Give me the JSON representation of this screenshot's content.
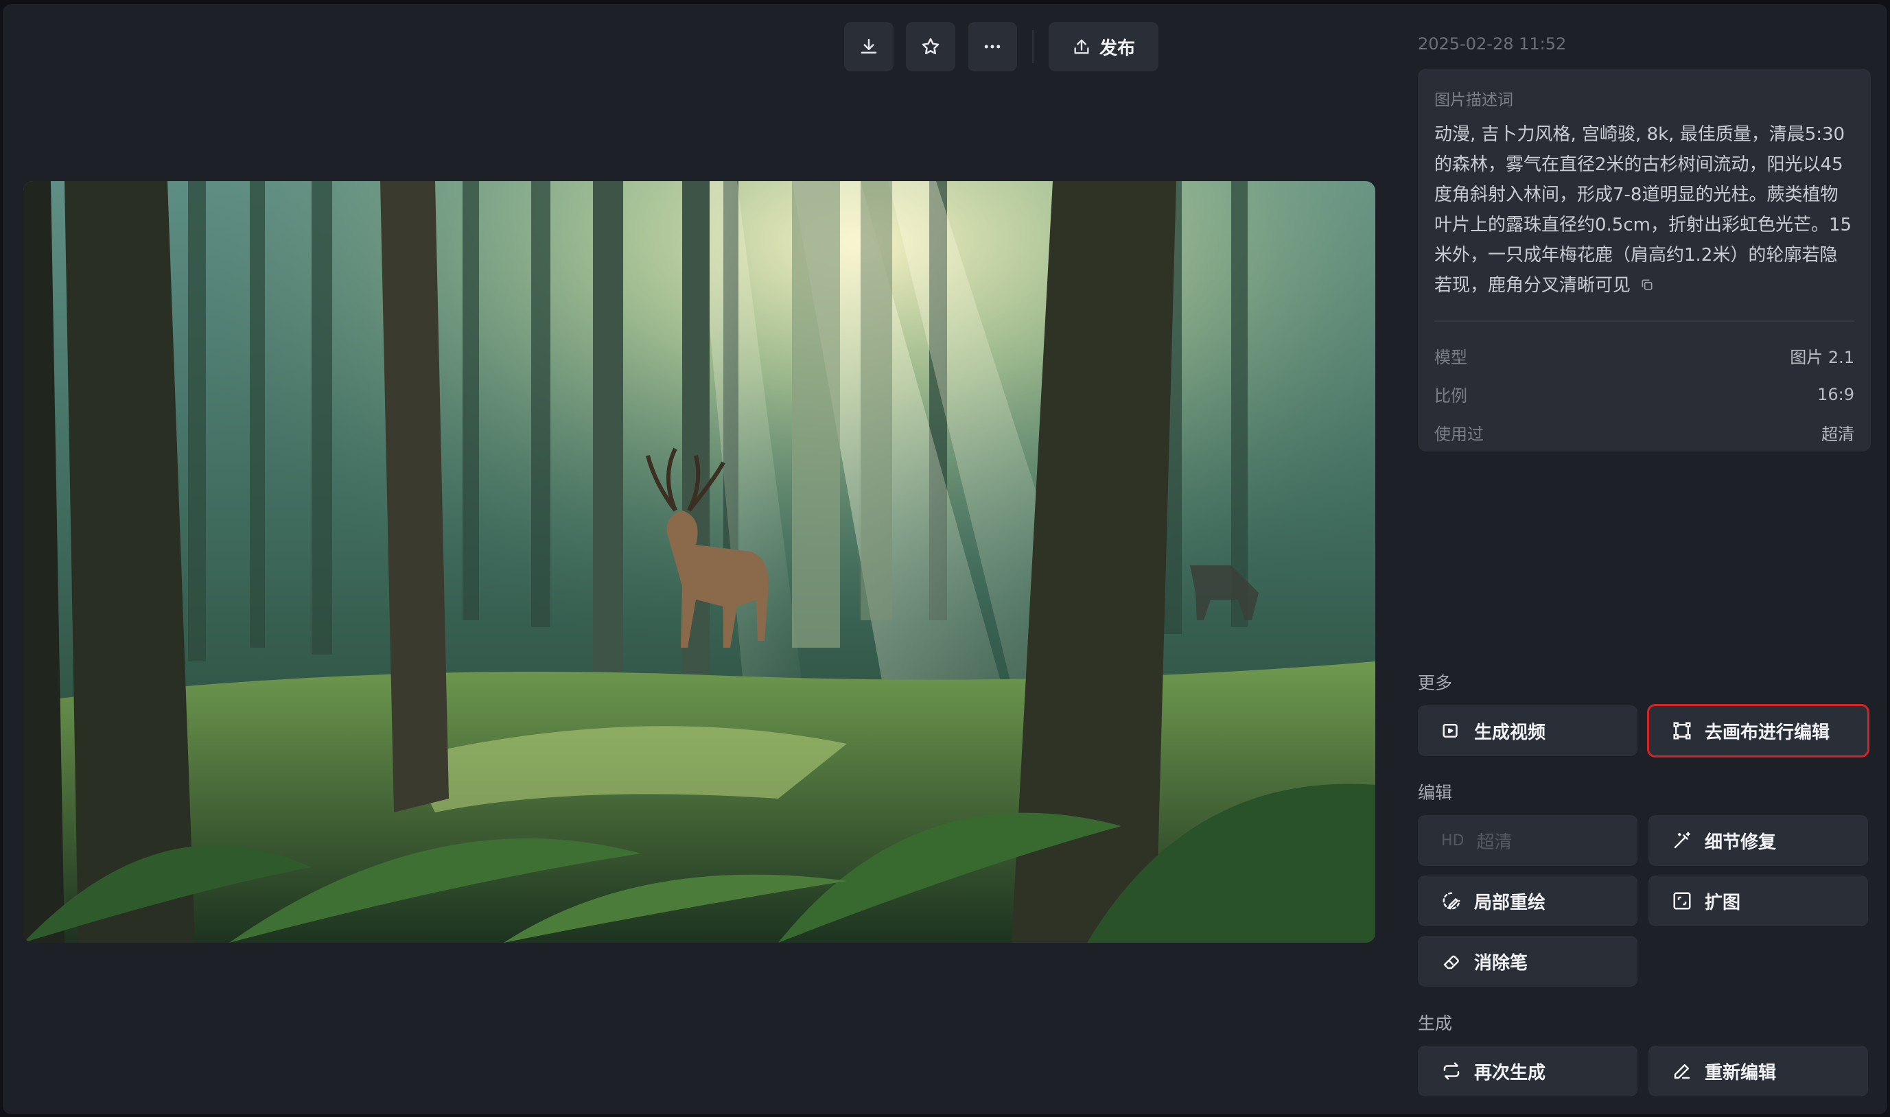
{
  "toolbar": {
    "download_icon": "download-icon",
    "favorite_icon": "star-icon",
    "more_icon": "more-icon",
    "publish_label": "发布"
  },
  "artwork": {
    "description": "anime-style misty cedar forest with sun rays, a stag and a second deer among ferns"
  },
  "details": {
    "timestamp": "2025-02-28 11:52",
    "prompt_label": "图片描述词",
    "prompt_text": "动漫, 吉卜力风格, 宫崎骏, 8k, 最佳质量，清晨5:30的森林，雾气在直径2米的古杉树间流动，阳光以45度角斜射入林间，形成7-8道明显的光柱。蕨类植物叶片上的露珠直径约0.5cm，折射出彩虹色光芒。15米外，一只成年梅花鹿（肩高约1.2米）的轮廓若隐若现，鹿角分叉清晰可见",
    "meta": [
      {
        "key": "模型",
        "value": "图片 2.1"
      },
      {
        "key": "比例",
        "value": "16:9"
      },
      {
        "key": "使用过",
        "value": "超清"
      }
    ]
  },
  "sections": {
    "more": "更多",
    "edit": "编辑",
    "generate": "生成"
  },
  "actions": {
    "generate_video": "生成视频",
    "canvas_edit": "去画布进行编辑",
    "hd_tag": "HD",
    "upscale": "超清",
    "detail_repair": "细节修复",
    "inpaint": "局部重绘",
    "outpaint": "扩图",
    "eraser": "消除笔",
    "regenerate": "再次生成",
    "re_edit": "重新编辑"
  },
  "colors": {
    "background": "#1d2027",
    "card": "#2a2d35",
    "button": "#2a2e37",
    "highlight": "#d62424"
  }
}
